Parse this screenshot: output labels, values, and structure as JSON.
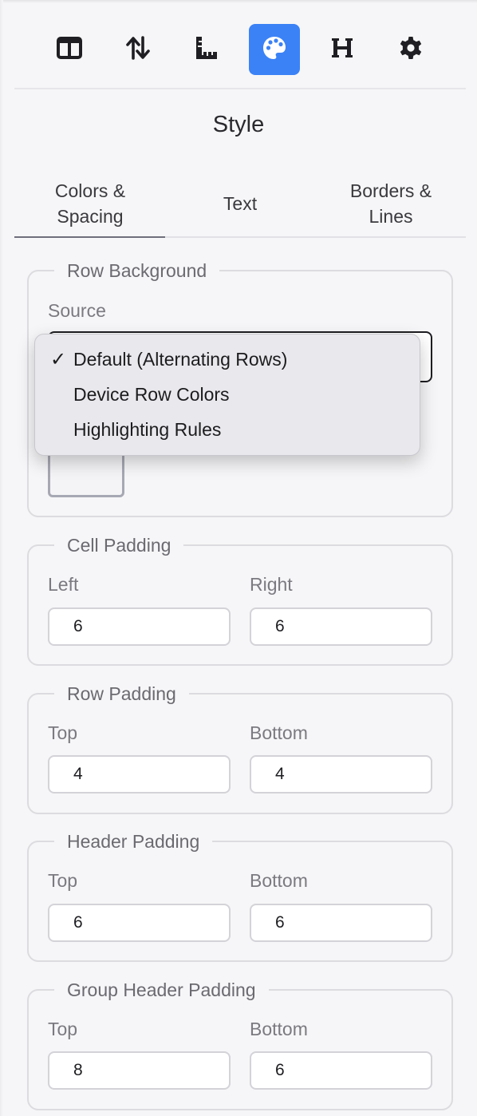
{
  "toolbar": {
    "buttons": [
      {
        "icon": "columns-icon",
        "active": false
      },
      {
        "icon": "sort-arrows-icon",
        "active": false
      },
      {
        "icon": "ruler-icon",
        "active": false
      },
      {
        "icon": "palette-icon",
        "active": true
      },
      {
        "icon": "heading-icon",
        "active": false
      },
      {
        "icon": "gear-icon",
        "active": false
      }
    ],
    "active_color": "#3b82f6"
  },
  "panel": {
    "title": "Style"
  },
  "tabs": [
    {
      "label": "Colors & Spacing",
      "line1": "Colors &",
      "line2": "Spacing",
      "active": true
    },
    {
      "label": "Text",
      "line1": "Text",
      "line2": "",
      "active": false
    },
    {
      "label": "Borders & Lines",
      "line1": "Borders &",
      "line2": "Lines",
      "active": false
    }
  ],
  "row_background": {
    "legend": "Row Background",
    "source_label": "Source",
    "selected": "Default (Alternating Rows)",
    "options": [
      "Default (Alternating Rows)",
      "Device Row Colors",
      "Highlighting Rules"
    ],
    "check_mark": "✓"
  },
  "cell_padding": {
    "legend": "Cell Padding",
    "left_label": "Left",
    "left_value": "6",
    "right_label": "Right",
    "right_value": "6"
  },
  "row_padding": {
    "legend": "Row Padding",
    "top_label": "Top",
    "top_value": "4",
    "bottom_label": "Bottom",
    "bottom_value": "4"
  },
  "header_padding": {
    "legend": "Header Padding",
    "top_label": "Top",
    "top_value": "6",
    "bottom_label": "Bottom",
    "bottom_value": "6"
  },
  "group_header_padding": {
    "legend": "Group Header Padding",
    "top_label": "Top",
    "top_value": "8",
    "bottom_label": "Bottom",
    "bottom_value": "6"
  }
}
